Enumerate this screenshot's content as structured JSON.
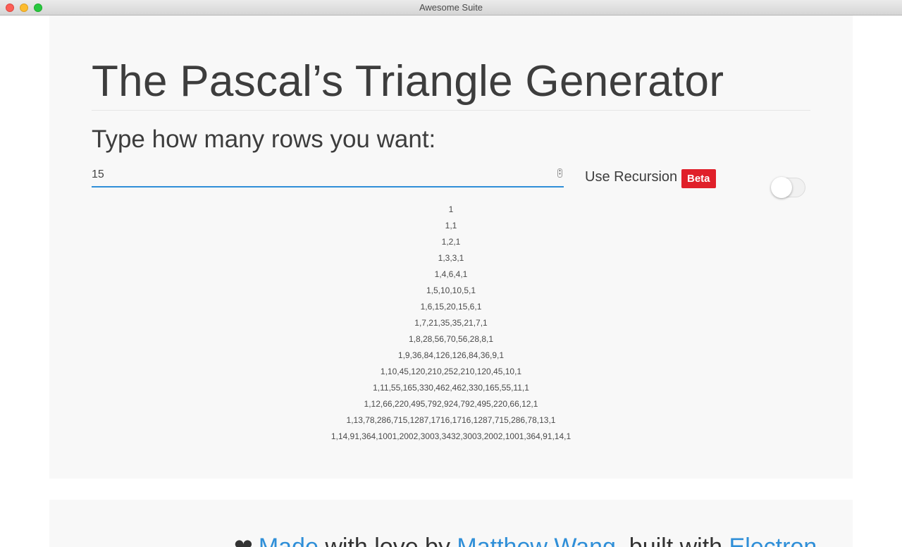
{
  "window": {
    "title": "Awesome Suite"
  },
  "main": {
    "title": "The Pascal’s Triangle Generator",
    "prompt": "Type how many rows you want:",
    "rows_input": {
      "value": "15",
      "type": "number"
    },
    "use_recursion": {
      "label": "Use Recursion",
      "badge": "Beta",
      "enabled": false
    },
    "triangle_rows": [
      "1",
      "1,1",
      "1,2,1",
      "1,3,3,1",
      "1,4,6,4,1",
      "1,5,10,10,5,1",
      "1,6,15,20,15,6,1",
      "1,7,21,35,35,21,7,1",
      "1,8,28,56,70,56,28,8,1",
      "1,9,36,84,126,126,84,36,9,1",
      "1,10,45,120,210,252,210,120,45,10,1",
      "1,11,55,165,330,462,462,330,165,55,11,1",
      "1,12,66,220,495,792,924,792,495,220,66,12,1",
      "1,13,78,286,715,1287,1716,1716,1287,715,286,78,13,1",
      "1,14,91,364,1001,2002,3003,3432,3003,2002,1001,364,91,14,1"
    ]
  },
  "footer": {
    "heart_icon": "heart-icon",
    "made_link": "Made",
    "text_with_love_by": " with love by ",
    "author_link": "Matthew Wang",
    "text_built_with": ", built with ",
    "framework_link": "Electron"
  },
  "colors": {
    "accent": "#2f8fd8",
    "badge": "#e0202a",
    "card_bg": "#f8f8f8",
    "title_text": "#3d3d3d"
  }
}
